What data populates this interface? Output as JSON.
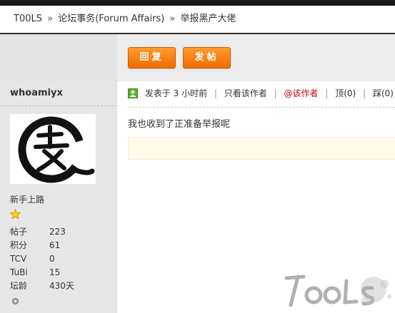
{
  "breadcrumb": {
    "home": "T00LS",
    "sep1": "»",
    "forum": "论坛事务(Forum Affairs)",
    "sep2": "»",
    "thread": "举报黑产大佬"
  },
  "toolbar": {
    "reply_label": "回复",
    "post_label": "发帖"
  },
  "user": {
    "name": "whoamiyx",
    "rank": "新手上路",
    "stats": [
      {
        "key": "帖子",
        "value": "223"
      },
      {
        "key": "积分",
        "value": "61"
      },
      {
        "key": "TCV",
        "value": "0"
      },
      {
        "key": "TuBi",
        "value": "15"
      },
      {
        "key": "坛龄",
        "value": "430天"
      }
    ]
  },
  "post": {
    "posted_at": "发表于 3 小时前",
    "only_author": "只看该作者",
    "at_author": "@该作者",
    "top": "顶(0)",
    "step": "踩(0)",
    "body": "我也收到了正准备举报呢"
  },
  "colors": {
    "accent": "#f07a10",
    "link_red": "#cc0000",
    "sidebar_bg": "#e6e6e6"
  },
  "icons": [
    "user-icon",
    "star-icon",
    "small-status-icon",
    "tools-logo"
  ]
}
